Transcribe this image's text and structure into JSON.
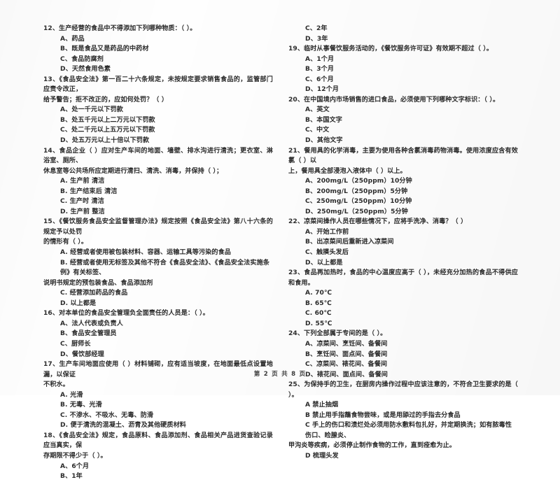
{
  "document": {
    "type": "scanned-exam-paper",
    "language": "zh-CN",
    "footer": {
      "prefix": "第",
      "page_number": "2",
      "middle": "页 共",
      "total_pages": "8",
      "suffix": "页",
      "full_text": "第 2 页 共 8 页"
    }
  },
  "left_column": {
    "blocks": [
      {
        "kind": "question",
        "text": "12、生产经营的食品中不得添加下列哪种物质：（      ）。"
      },
      {
        "kind": "option",
        "text": "A、药品"
      },
      {
        "kind": "option",
        "text": "B、既是食品又是药品的中药材"
      },
      {
        "kind": "option",
        "text": "C、食品防腐剂"
      },
      {
        "kind": "option",
        "text": "D、天然食用色素"
      },
      {
        "kind": "question",
        "text": "13、《食品安全法》第一百二十六条规定，未按规定要求销售食品的，监管部门应责令改正，"
      },
      {
        "kind": "question-cont",
        "text": "给予警告；拒不改正的，应如何处罚？（    ）"
      },
      {
        "kind": "option",
        "text": "A、处一千元以下罚款"
      },
      {
        "kind": "option",
        "text": "B、处五千元以上二万元以下罚款"
      },
      {
        "kind": "option",
        "text": "C、处二千元以上五万元以下罚款"
      },
      {
        "kind": "option",
        "text": "D、处五万元以上十倍以下罚款"
      },
      {
        "kind": "question",
        "text": "14、食品企业（      ）应对生产车间的地面、墙壁、排水沟进行清洗；更衣室、淋浴室、厕所、"
      },
      {
        "kind": "question-cont",
        "text": "休息室等公共场所应定期进行清扫、清洗、消毒，并保持（      ）；"
      },
      {
        "kind": "option",
        "text": "A. 生产前  清洁"
      },
      {
        "kind": "option",
        "text": "B. 生产结束后  清洁"
      },
      {
        "kind": "option",
        "text": "C. 生产时  清洁"
      },
      {
        "kind": "option",
        "text": "D. 生产前  整洁"
      },
      {
        "kind": "question",
        "text": "15、《餐饮服务食品安全监督管理办法》规定按照《食品安全法》第八十六条的规定予以处罚"
      },
      {
        "kind": "question-cont",
        "text": "的情形有（      ）。"
      },
      {
        "kind": "option",
        "text": "A. 经营或者使用被包装材料、容器、运输工具等污染的食品"
      },
      {
        "kind": "option",
        "text": "B. 经营或者使用无标签及其他不符合《食品安全法》、《食品安全法实施条例》有关标签、"
      },
      {
        "kind": "option-cont",
        "text": "说明书规定的预包装食品、食品添加剂"
      },
      {
        "kind": "option",
        "text": "C. 经营添加药品的食品"
      },
      {
        "kind": "option",
        "text": "D. 以上都是"
      },
      {
        "kind": "question",
        "text": "16、对本单位的食品安全管理负全面责任的人员是：（      ）。"
      },
      {
        "kind": "option",
        "text": "A、法人代表或负责人"
      },
      {
        "kind": "option",
        "text": "B、食品安全管理员"
      },
      {
        "kind": "option",
        "text": "C、厨师长"
      },
      {
        "kind": "option",
        "text": "D、餐饮部经理"
      },
      {
        "kind": "question",
        "text": "17、生产车间地面应使用（      ）材料铺砌，应有适当坡度，在地面最低点设置地漏，以保证"
      },
      {
        "kind": "question-cont",
        "text": "不积水。"
      },
      {
        "kind": "option",
        "text": "A. 光滑"
      },
      {
        "kind": "option",
        "text": "B. 无毒、光滑"
      },
      {
        "kind": "option",
        "text": "C. 不渗水、不吸水、无毒、防滑"
      },
      {
        "kind": "option",
        "text": "D. 便于清洗的混凝土、沥青及其他硬质材料"
      },
      {
        "kind": "question",
        "text": "18、《食品安全法》规定，食品原料、食品添加剂、食品相关产品进货查验记录应当真实，保"
      },
      {
        "kind": "question-cont",
        "text": "存期限不得少于（      ）。"
      },
      {
        "kind": "option",
        "text": "A、6个月"
      },
      {
        "kind": "option",
        "text": "B、1年"
      }
    ]
  },
  "right_column": {
    "blocks": [
      {
        "kind": "option",
        "text": "C、2年"
      },
      {
        "kind": "option",
        "text": "D、3年"
      },
      {
        "kind": "question",
        "text": "19、临时从事餐饮服务活动的，《餐饮服务许可证》有效期不超过（      ）。"
      },
      {
        "kind": "option",
        "text": "A、1个月"
      },
      {
        "kind": "option",
        "text": "B、3个月"
      },
      {
        "kind": "option",
        "text": "C、6个月"
      },
      {
        "kind": "option",
        "text": "D、12个月"
      },
      {
        "kind": "question",
        "text": "20、在中国境内市场销售的进口食品，必须使用下列哪种文字标识：（      ）。"
      },
      {
        "kind": "option",
        "text": "A、英文"
      },
      {
        "kind": "option",
        "text": "B、本国文字"
      },
      {
        "kind": "option",
        "text": "C、中文"
      },
      {
        "kind": "option",
        "text": "D、其他文字"
      },
      {
        "kind": "question",
        "text": "21、餐用具的化学消毒，主要为使用各种含氯消毒药物消毒。使用浓度应含有效氯（      ）以"
      },
      {
        "kind": "question-cont",
        "text": "上，餐用具全部浸泡入液体中（      ）以上。"
      },
      {
        "kind": "option",
        "text": "A、200mg/L（250ppm）10分钟"
      },
      {
        "kind": "option",
        "text": "B、200mg/L（250ppm）5分钟"
      },
      {
        "kind": "option",
        "text": "C、250mg/L（250ppm）10分钟"
      },
      {
        "kind": "option",
        "text": "D、250mg/L（250ppm）5分钟"
      },
      {
        "kind": "question",
        "text": "22、凉菜间操作人员在哪些情况下，应将手洗净、消毒？（      ）"
      },
      {
        "kind": "option",
        "text": "A、开始工作前"
      },
      {
        "kind": "option",
        "text": "B、出凉菜间后重新进入凉菜间"
      },
      {
        "kind": "option",
        "text": "C、触摸头发后"
      },
      {
        "kind": "option",
        "text": "D、以上都是"
      },
      {
        "kind": "question",
        "text": "23、食品再加热时，食品的中心温度应高于（      ），未经充分加热的食品不得供应和食用。"
      },
      {
        "kind": "option",
        "text": "A. 70℃"
      },
      {
        "kind": "option",
        "text": "B. 65℃"
      },
      {
        "kind": "option",
        "text": "C. 60℃"
      },
      {
        "kind": "option",
        "text": "D. 55℃"
      },
      {
        "kind": "question",
        "text": "24、下列全部属于专间的是（      ）。"
      },
      {
        "kind": "option",
        "text": "A、凉菜间、烹饪间、备餐间"
      },
      {
        "kind": "option",
        "text": "B、烹饪间、面点间、备餐间"
      },
      {
        "kind": "option",
        "text": "C、凉菜间、裱花间、备餐间"
      },
      {
        "kind": "option",
        "text": "D、裱花间、面点间、备餐间"
      },
      {
        "kind": "question",
        "text": "25、为保持手的卫生，在厨房内操作过程中应该注意的，不符合卫生要求的是（      ）。"
      },
      {
        "kind": "option",
        "text": "A 禁止抽烟"
      },
      {
        "kind": "option",
        "text": "B 禁止用手指蘸食物尝味，或是用舔过的手指去分食品"
      },
      {
        "kind": "option",
        "text": "C  手上的伤口和溃烂处必须用防水敷料包扎好，并定期换洗；如有脓毒性伤口、睑腺炎、"
      },
      {
        "kind": "option-cont",
        "text": "甲沟炎等疾病，必须停止制作食物的工作，直到痊愈为止。"
      },
      {
        "kind": "option",
        "text": "D 梳理头发"
      }
    ]
  }
}
